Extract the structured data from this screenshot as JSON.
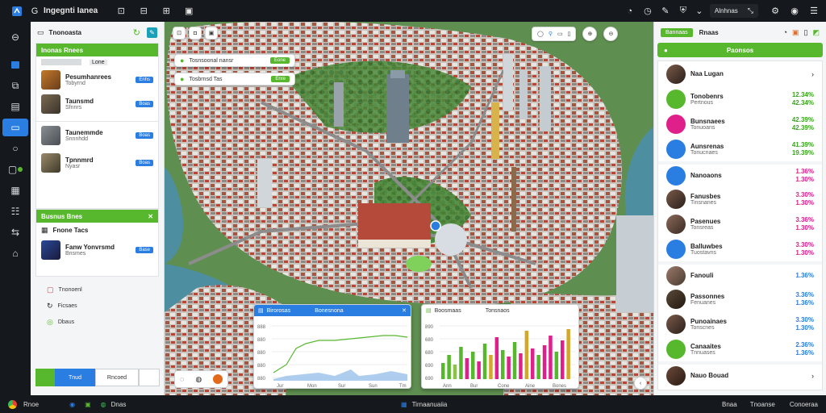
{
  "topbar": {
    "title": "Ingegnti Ianea",
    "right_label": "Alnhnas"
  },
  "left_panel": {
    "title": "Tnonoasta",
    "section1": {
      "title": "Inonas Rnees",
      "tab": "Lone"
    },
    "items": [
      {
        "name": "Pesumhanrees",
        "sub": "Tobyrnd",
        "btn": "Enhs"
      },
      {
        "name": "Taunsmd",
        "sub": "Sfnnrs",
        "btn": "Boas"
      },
      {
        "name": "Taunemmde",
        "sub": "Snnnhdd",
        "btn": "Boas"
      },
      {
        "name": "Tpnnmrd",
        "sub": "Nyasr",
        "btn": "Boas"
      }
    ],
    "section2": {
      "title": "Busnus Bnes"
    },
    "sub_label": "Fnone Tacs",
    "feature": {
      "name": "Fanw Yonvrsmd",
      "sub": "Bnsmes",
      "btn": "Base"
    },
    "links": [
      "Tnonoenl",
      "Ficsaes",
      "Dbaus"
    ],
    "footer": {
      "left_btn": "Tnud",
      "right_btn": "Rncoed"
    }
  },
  "map": {
    "chips": [
      {
        "label": "Tosnsoonal nansr",
        "btn": "Eone"
      },
      {
        "label": "Tosbrnsd Tas",
        "btn": "Enre"
      }
    ]
  },
  "charts": [
    {
      "title": "Birorosas",
      "subtitle": "Bonesnona",
      "yticks": [
        "888",
        "880",
        "880",
        "880",
        "880"
      ],
      "xticks": [
        "Jur",
        "Mon",
        "Sur",
        "Sun",
        "Tm"
      ]
    },
    {
      "title": "Boosmaas",
      "subtitle": "Tonsnaos",
      "yticks": [
        "890",
        "680",
        "680",
        "690",
        "690"
      ],
      "xticks": [
        "Ann",
        "Bur",
        "Cone",
        "Aine",
        "Bones"
      ]
    }
  ],
  "right_panel": {
    "header_btn": "Bannaas",
    "header_label": "Rnaas",
    "section_title": "Paonsos",
    "items": [
      {
        "name": "Naa Lugan",
        "sub": "",
        "v1": "",
        "v2": "",
        "color": "photo"
      },
      {
        "name": "Tonobenrs",
        "sub": "Pertnous",
        "v1": "12.34%",
        "v2": "42.34%",
        "color": "#57b82e"
      },
      {
        "name": "Bunsnaees",
        "sub": "Tonuoans",
        "v1": "42.39%",
        "v2": "42.39%",
        "color": "#e0208a"
      },
      {
        "name": "Aunsrenas",
        "sub": "Tonucnaes",
        "v1": "41.39%",
        "v2": "19.39%",
        "color": "#2a7de1"
      },
      {
        "name": "Nanoaons",
        "sub": "",
        "v1": "1.36%",
        "v2": "1.30%",
        "color": "#2a7de1"
      },
      {
        "name": "Fanusbes",
        "sub": "Tinsnanes",
        "v1": "3.30%",
        "v2": "1.30%",
        "color": "photo"
      },
      {
        "name": "Pasenues",
        "sub": "Tonsreas",
        "v1": "3.36%",
        "v2": "1.30%",
        "color": "photo"
      },
      {
        "name": "Balluwbes",
        "sub": "Tuostavns",
        "v1": "3.30%",
        "v2": "1.30%",
        "color": "#2a7de1"
      },
      {
        "name": "Fanouli",
        "sub": "",
        "v1": "1.36%",
        "v2": "",
        "color": "photo"
      },
      {
        "name": "Passonnes",
        "sub": "Fenuanes",
        "v1": "3.36%",
        "v2": "1.36%",
        "color": "photo"
      },
      {
        "name": "Punoainaes",
        "sub": "Tonscnes",
        "v1": "3.30%",
        "v2": "1.30%",
        "color": "photo"
      },
      {
        "name": "Canaaites",
        "sub": "Tnnuases",
        "v1": "2.36%",
        "v2": "1.36%",
        "color": "#57b82e"
      },
      {
        "name": "Nauo Bouad",
        "sub": "",
        "v1": "",
        "v2": "",
        "color": "photo"
      }
    ]
  },
  "taskbar": {
    "left_label": "Rnoe",
    "app_label": "Dnas",
    "center_label": "Tirnaanuaiia",
    "right_label1": "Bnaa",
    "right_label2": "Tnoanse",
    "right_label3": "Conoeraa"
  },
  "colors": {
    "accent_green": "#57b82e",
    "accent_blue": "#2a7de1",
    "accent_pink": "#e0208a",
    "dark_bar": "#15181c"
  }
}
